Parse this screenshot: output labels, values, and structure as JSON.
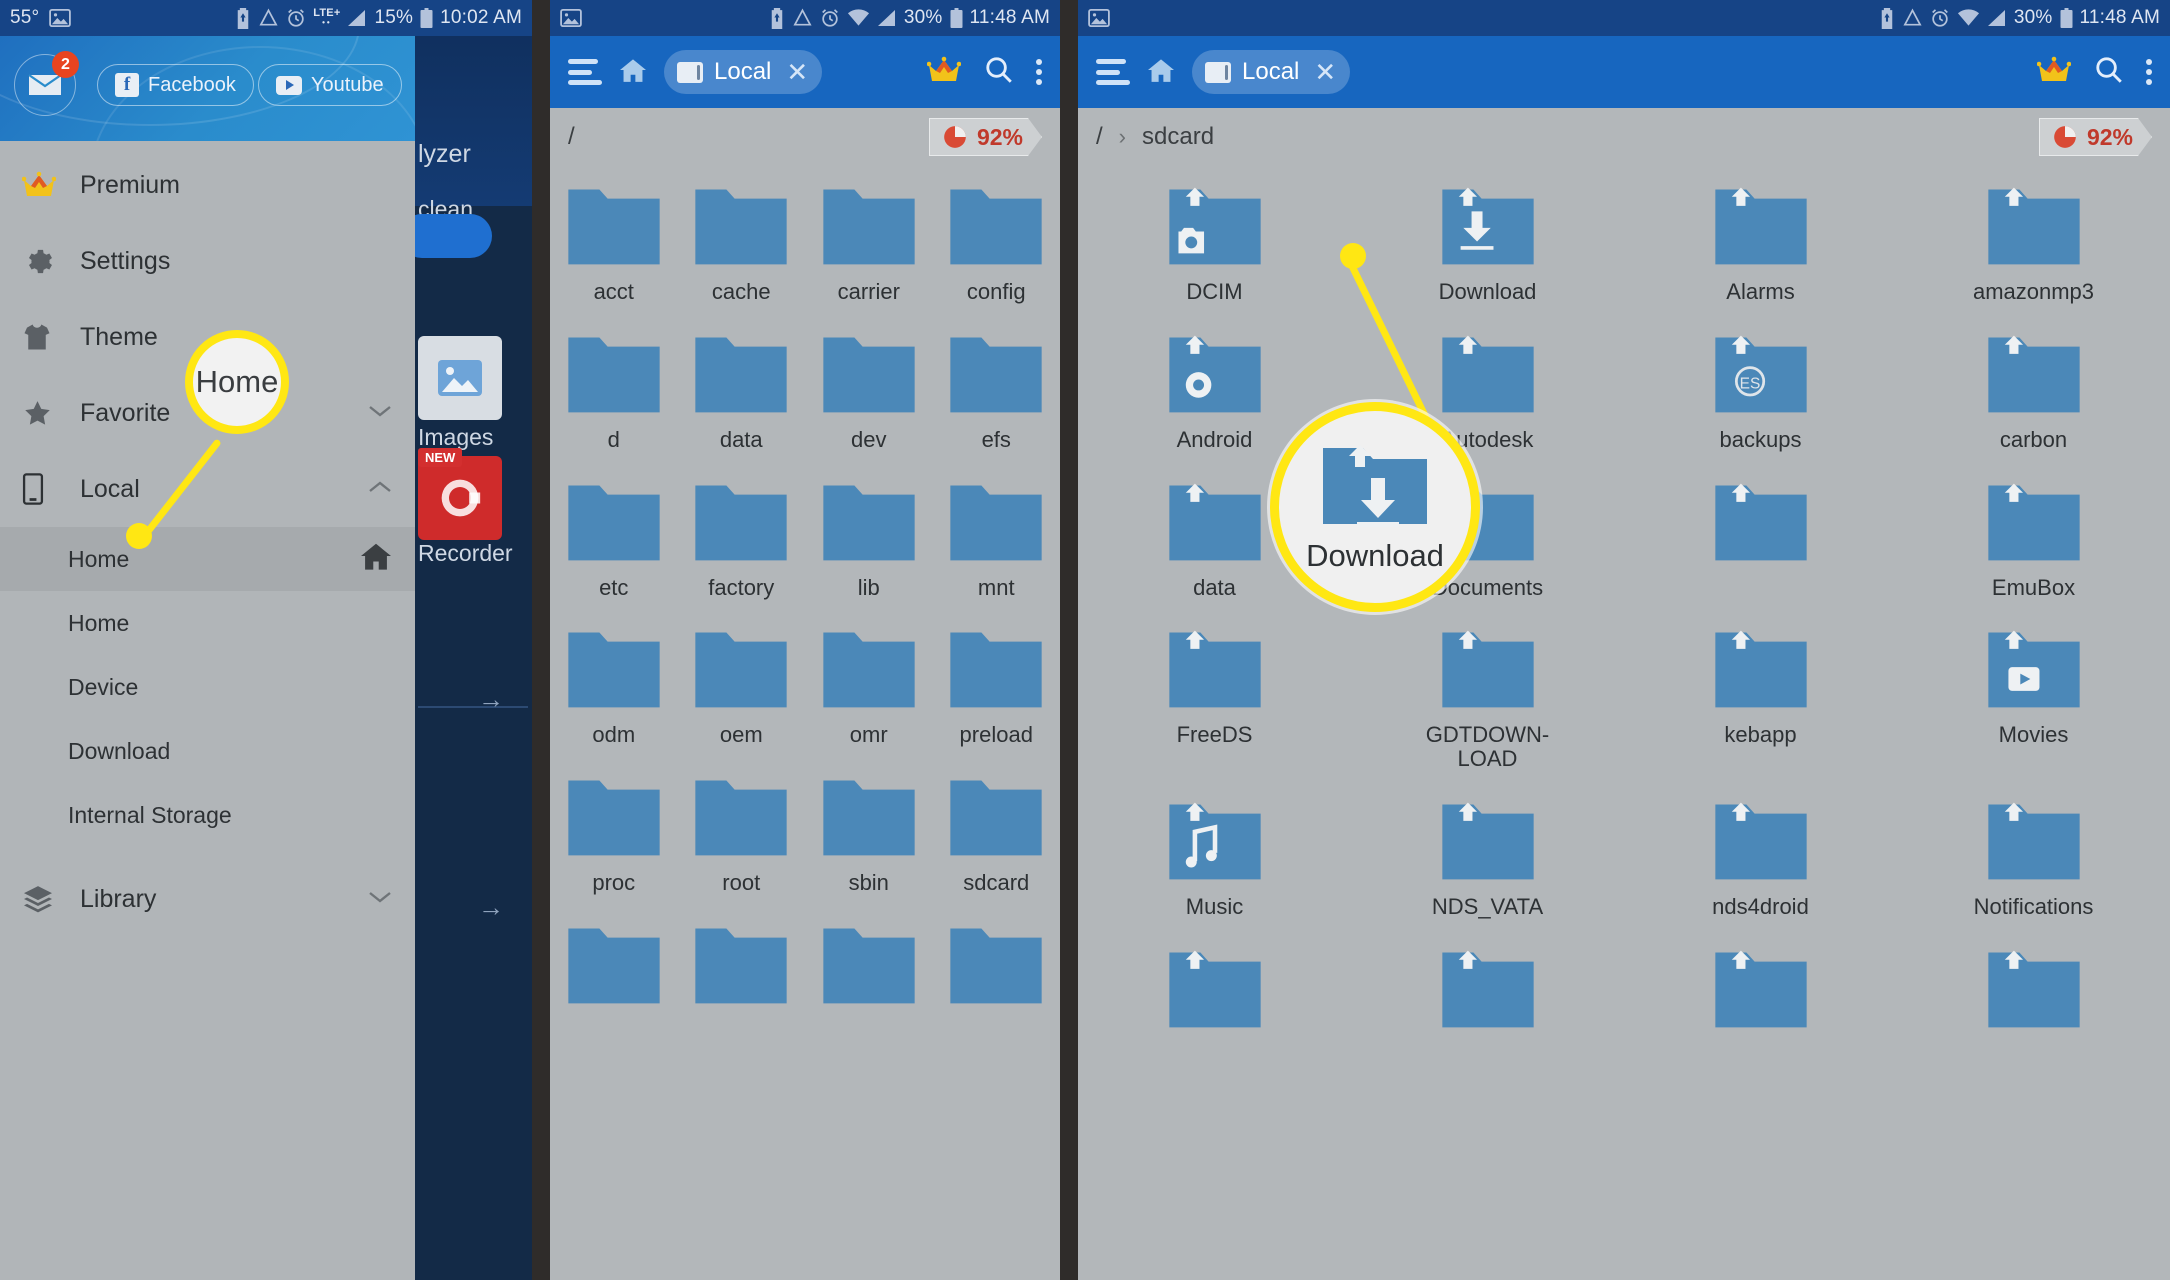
{
  "panel1": {
    "statusbar": {
      "temp": "55°",
      "battery": "15%",
      "time": "10:02 AM",
      "network": "LTE+",
      "icons": [
        "image-icon",
        "battery-saver-icon",
        "data-saver-icon",
        "alarm-icon",
        "signal-icon"
      ]
    },
    "drawer_header": {
      "mail_badge": "2",
      "facebook_label": "Facebook",
      "youtube_label": "Youtube"
    },
    "menu": [
      {
        "label": "Premium",
        "icon": "crown-icon",
        "chevron": ""
      },
      {
        "label": "Settings",
        "icon": "gear-icon",
        "chevron": ""
      },
      {
        "label": "Theme",
        "icon": "tshirt-icon",
        "chevron": ""
      },
      {
        "label": "Favorite",
        "icon": "star-icon",
        "chevron": "⌄"
      },
      {
        "label": "Local",
        "icon": "phone-icon",
        "chevron": "⌃"
      }
    ],
    "sub_items": [
      {
        "label": "Home",
        "active": true,
        "trailing_icon": "home-icon"
      },
      {
        "label": "Home",
        "active": false,
        "trailing_icon": ""
      },
      {
        "label": "Device",
        "active": false,
        "trailing_icon": ""
      },
      {
        "label": "Download",
        "active": false,
        "trailing_icon": ""
      },
      {
        "label": "Internal Storage",
        "active": false,
        "trailing_icon": ""
      }
    ],
    "library": {
      "label": "Library",
      "icon": "layers-icon",
      "chevron": "⌄"
    },
    "callout": {
      "text": "Home"
    },
    "background": {
      "word_analyzer": "lyzer",
      "word_clean": "clean",
      "label_images": "Images",
      "label_recorder": "Recorder",
      "badge_new": "NEW"
    }
  },
  "panel2": {
    "statusbar": {
      "battery": "30%",
      "time": "11:48 AM",
      "icons": [
        "image-icon",
        "battery-saver-icon",
        "data-saver-icon",
        "alarm-icon",
        "wifi-icon",
        "signal-icon"
      ]
    },
    "toolbar": {
      "tab_label": "Local",
      "home_icon": "home-icon",
      "menu_icon": "hamburger-icon",
      "crown_icon": "crown-icon",
      "search_icon": "search-icon",
      "overflow_icon": "overflow-menu-icon",
      "close_icon": "close-icon"
    },
    "breadcrumb": {
      "path": "/",
      "storage_badge": "92%"
    },
    "folders": [
      {
        "name": "acct",
        "glyph": ""
      },
      {
        "name": "cache",
        "glyph": ""
      },
      {
        "name": "carrier",
        "glyph": ""
      },
      {
        "name": "config",
        "glyph": ""
      },
      {
        "name": "d",
        "glyph": ""
      },
      {
        "name": "data",
        "glyph": ""
      },
      {
        "name": "dev",
        "glyph": ""
      },
      {
        "name": "efs",
        "glyph": ""
      },
      {
        "name": "etc",
        "glyph": ""
      },
      {
        "name": "factory",
        "glyph": ""
      },
      {
        "name": "lib",
        "glyph": ""
      },
      {
        "name": "mnt",
        "glyph": ""
      },
      {
        "name": "odm",
        "glyph": ""
      },
      {
        "name": "oem",
        "glyph": ""
      },
      {
        "name": "omr",
        "glyph": ""
      },
      {
        "name": "preload",
        "glyph": ""
      },
      {
        "name": "proc",
        "glyph": ""
      },
      {
        "name": "root",
        "glyph": ""
      },
      {
        "name": "sbin",
        "glyph": ""
      },
      {
        "name": "sdcard",
        "glyph": ""
      },
      {
        "name": "",
        "glyph": ""
      },
      {
        "name": "",
        "glyph": ""
      },
      {
        "name": "",
        "glyph": ""
      },
      {
        "name": "",
        "glyph": ""
      }
    ]
  },
  "panel3": {
    "statusbar": {
      "battery": "30%",
      "time": "11:48 AM",
      "icons": [
        "image-icon",
        "battery-saver-icon",
        "data-saver-icon",
        "alarm-icon",
        "wifi-icon",
        "signal-icon"
      ]
    },
    "toolbar": {
      "tab_label": "Local",
      "home_icon": "home-icon",
      "menu_icon": "hamburger-icon",
      "crown_icon": "crown-icon",
      "search_icon": "search-icon",
      "overflow_icon": "overflow-menu-icon",
      "close_icon": "close-icon"
    },
    "breadcrumb": {
      "root": "/",
      "path": "sdcard",
      "storage_badge": "92%"
    },
    "folders": [
      {
        "name": "DCIM",
        "glyph": "camera"
      },
      {
        "name": "Download",
        "glyph": "download"
      },
      {
        "name": "Alarms",
        "glyph": ""
      },
      {
        "name": "amazonmp3",
        "glyph": ""
      },
      {
        "name": "Android",
        "glyph": "android"
      },
      {
        "name": "Autodesk",
        "glyph": ""
      },
      {
        "name": "backups",
        "glyph": "es"
      },
      {
        "name": "carbon",
        "glyph": ""
      },
      {
        "name": "data",
        "glyph": ""
      },
      {
        "name": "Documents",
        "glyph": ""
      },
      {
        "name": "",
        "glyph": ""
      },
      {
        "name": "EmuBox",
        "glyph": ""
      },
      {
        "name": "FreeDS",
        "glyph": ""
      },
      {
        "name": "GDTDOWN-LOAD",
        "glyph": ""
      },
      {
        "name": "kebapp",
        "glyph": ""
      },
      {
        "name": "Movies",
        "glyph": "play"
      },
      {
        "name": "Music",
        "glyph": "music"
      },
      {
        "name": "NDS_VATA",
        "glyph": ""
      },
      {
        "name": "nds4droid",
        "glyph": ""
      },
      {
        "name": "Notifications",
        "glyph": ""
      },
      {
        "name": "",
        "glyph": ""
      },
      {
        "name": "",
        "glyph": ""
      },
      {
        "name": "",
        "glyph": ""
      },
      {
        "name": "",
        "glyph": ""
      }
    ],
    "callout": {
      "text": "Download"
    }
  },
  "colors": {
    "status_bar": "#164486",
    "toolbar": "#1766bf",
    "page_bg": "#b3b7ba",
    "folder": "#4b88b8",
    "highlight": "#ffe713",
    "badge_red": "#c0392b"
  }
}
